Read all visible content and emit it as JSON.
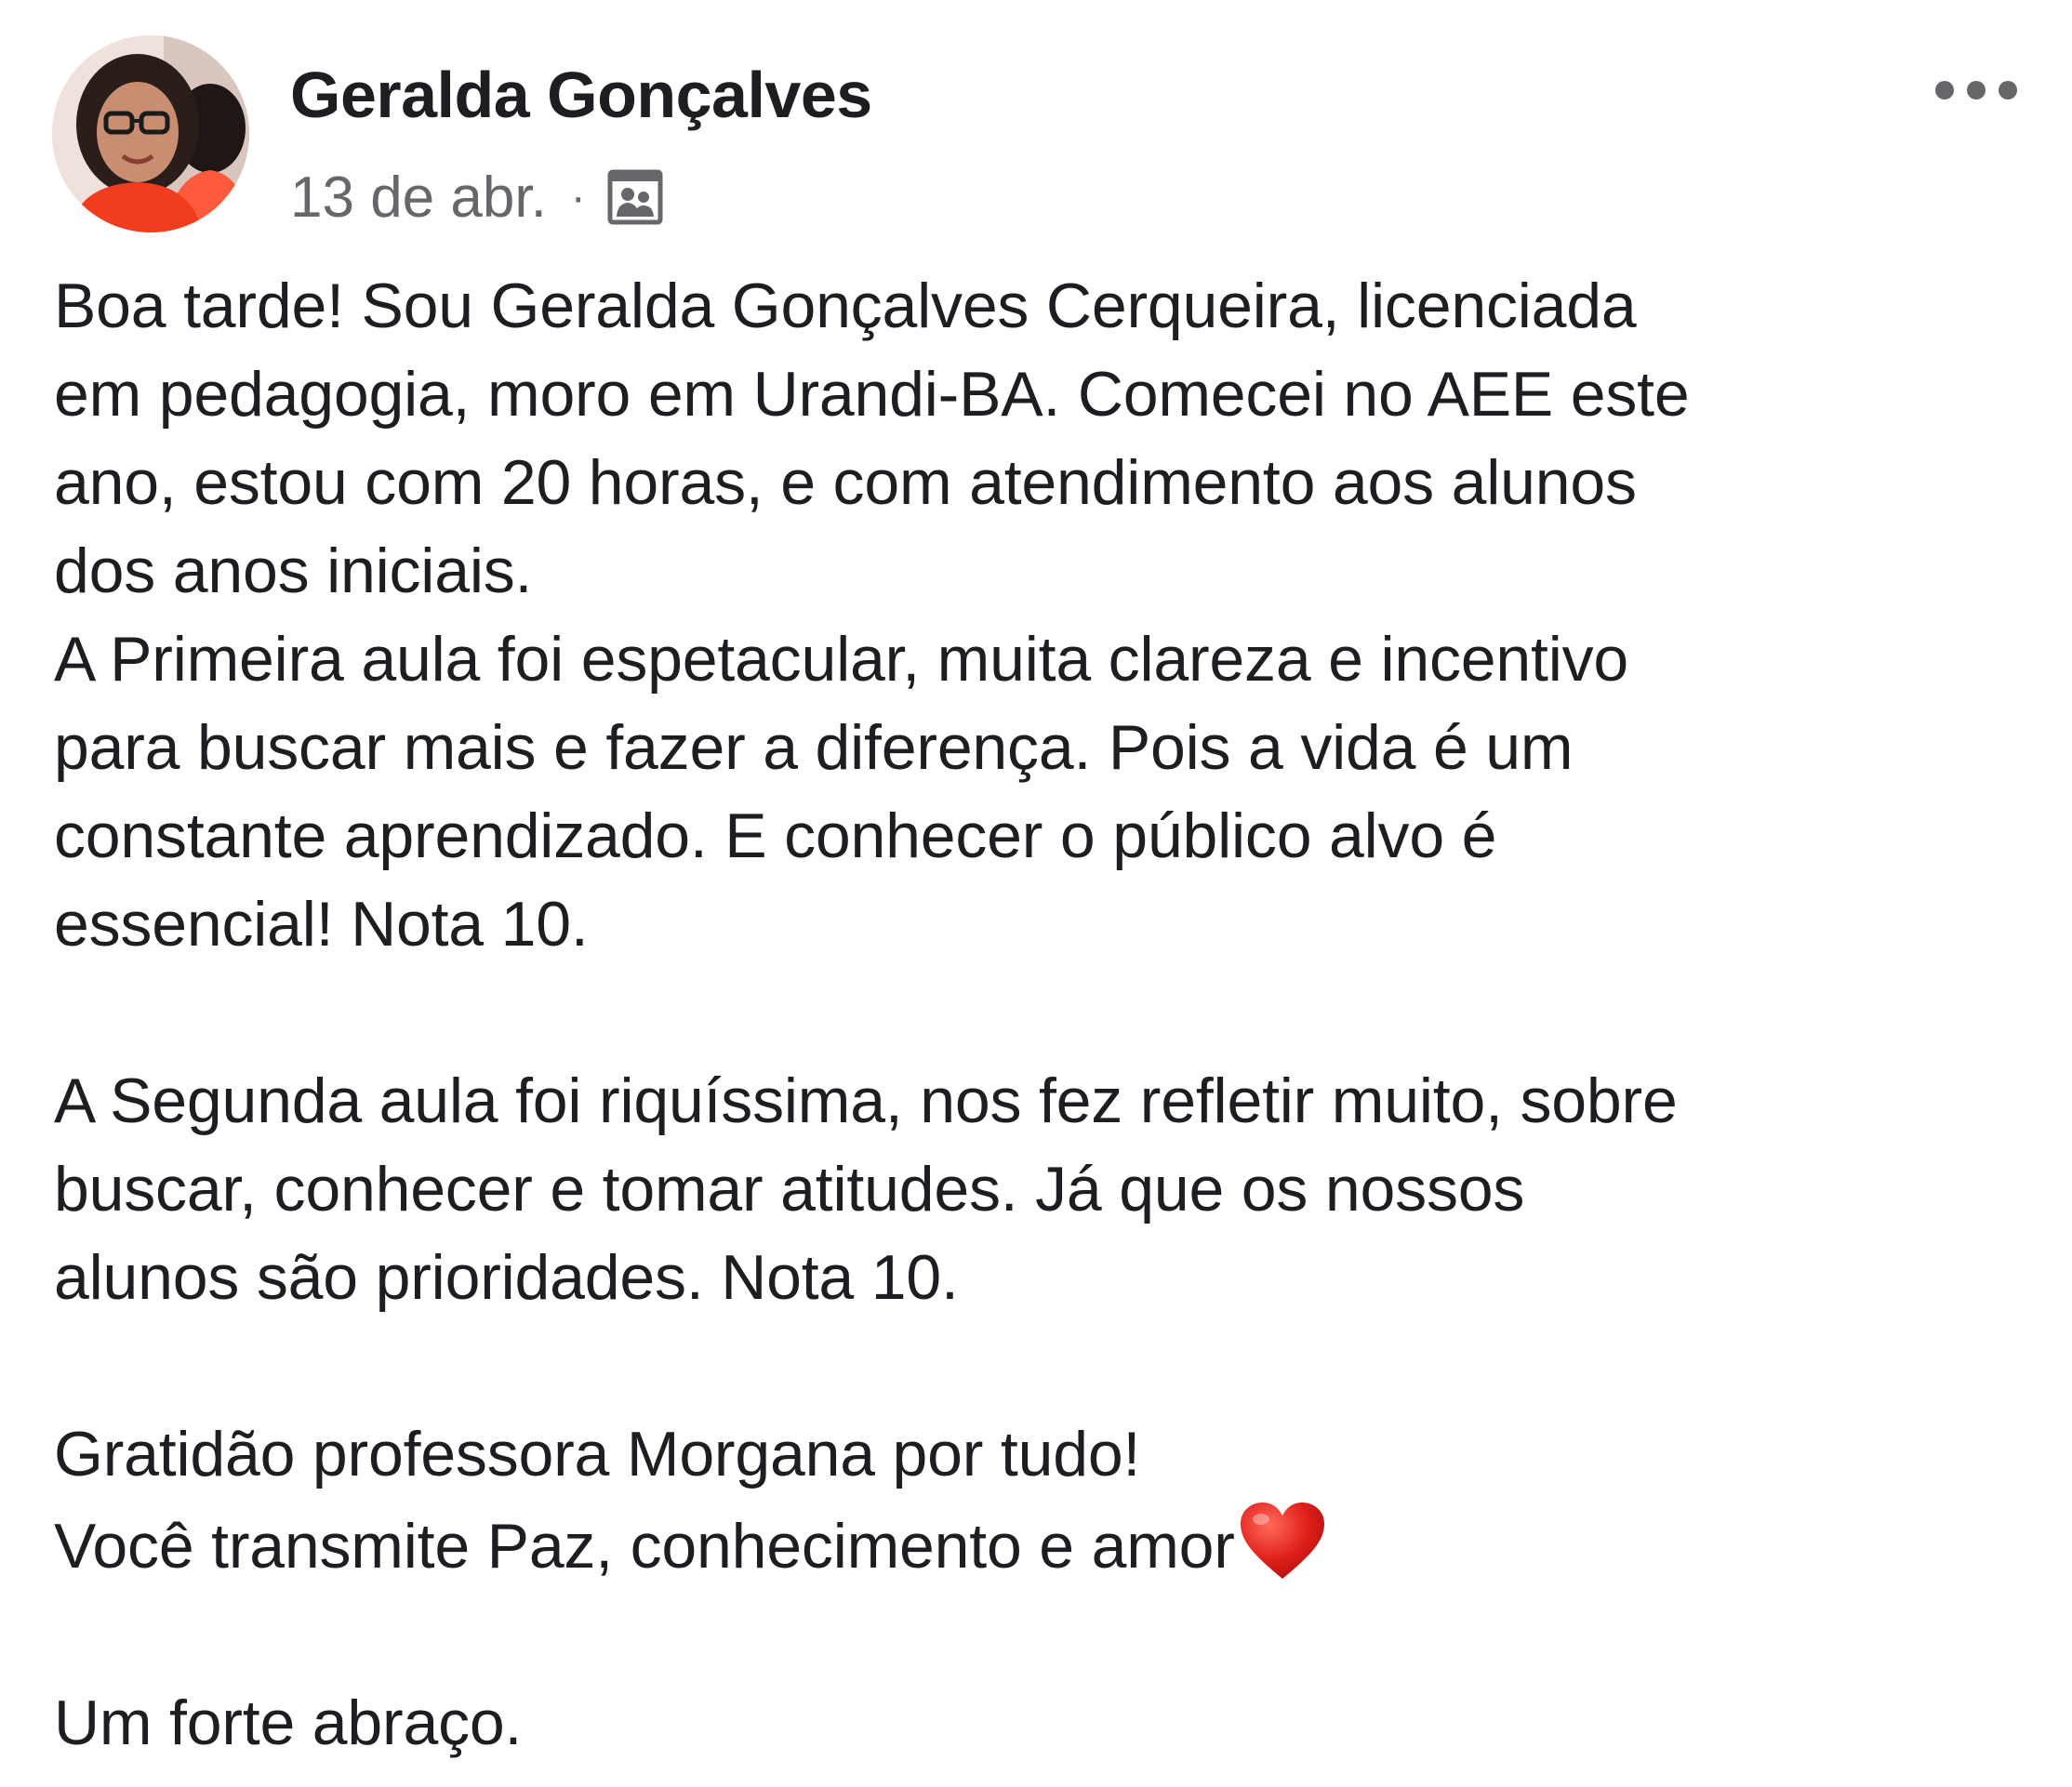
{
  "post": {
    "author": {
      "name": "Geralda Gonçalves",
      "avatar_icon": "profile-photo"
    },
    "timestamp": "13 de abr.",
    "separator": "·",
    "audience_icon": "friends-audience-icon",
    "more_icon": "more-options-icon",
    "body": {
      "paragraph1": "Boa tarde! Sou Geralda Gonçalves Cerqueira, licenciada\nem pedagogia, moro em Urandi-BA. Comecei no AEE este\nano,  estou com 20 horas, e com atendimento aos alunos\ndos anos iniciais.\nA Primeira aula foi espetacular, muita clareza e incentivo\npara buscar mais e fazer a diferença. Pois a vida é um\nconstante aprendizado. E conhecer o público alvo é\nessencial!  Nota 10.",
      "paragraph2": "A Segunda aula foi riquíssima, nos fez refletir muito, sobre\nbuscar, conhecer e tomar atitudes. Já que os nossos\nalunos são prioridades.  Nota 10.",
      "paragraph3_line1": "Gratidão professora  Morgana por tudo!",
      "paragraph3_line2": "Você transmite Paz, conhecimento e amor",
      "heart_emoji": "heart-icon",
      "closing": "Um forte abraço."
    },
    "colors": {
      "text": "#1c1e21",
      "secondary_text": "#65676b",
      "heart": "#e0201b"
    }
  }
}
